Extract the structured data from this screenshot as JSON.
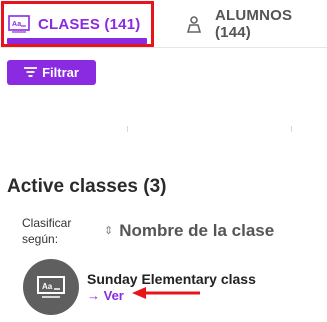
{
  "tabs": [
    {
      "label": "CLASES (141)",
      "icon": "classroom-icon",
      "active": true
    },
    {
      "label": "ALUMNOS (144)",
      "icon": "student-icon",
      "active": false
    }
  ],
  "filter": {
    "label": "Filtrar",
    "icon": "filter-icon"
  },
  "section": {
    "title": "Active classes (3)"
  },
  "sort": {
    "label": "Clasificar según:",
    "value": "Nombre de la clase"
  },
  "classes": [
    {
      "name": "Sunday Elementary class",
      "link": "→ Ver"
    }
  ],
  "colors": {
    "accent": "#8a2be2",
    "highlight": "#e8141b",
    "avatar": "#5f5f5f"
  }
}
